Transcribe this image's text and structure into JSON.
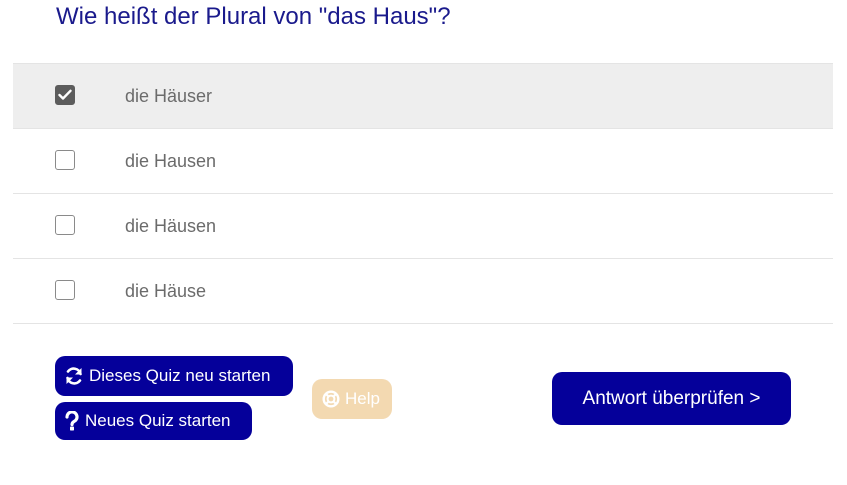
{
  "question": {
    "text": "Wie heißt der Plural von \"das Haus\"?"
  },
  "options": [
    {
      "label": "die Häuser",
      "checked": true
    },
    {
      "label": "die Hausen",
      "checked": false
    },
    {
      "label": "die Häusen",
      "checked": false
    },
    {
      "label": "die Häuse",
      "checked": false
    }
  ],
  "buttons": {
    "restart_label": "Dieses Quiz neu starten",
    "new_quiz_label": "Neues Quiz starten",
    "help_label": "Help",
    "check_label": "Antwort überprüfen >"
  },
  "icons": {
    "restart": "refresh-icon",
    "new_quiz": "question-icon",
    "help": "lifebuoy-icon",
    "checkbox_checked": "checkmark-icon"
  },
  "colors": {
    "primary": "#05009a",
    "question_text": "#1a1a8c",
    "help_disabled": "#f3d9b1",
    "selected_row": "#eeeeee",
    "checkbox_checked": "#5c5c5c"
  }
}
